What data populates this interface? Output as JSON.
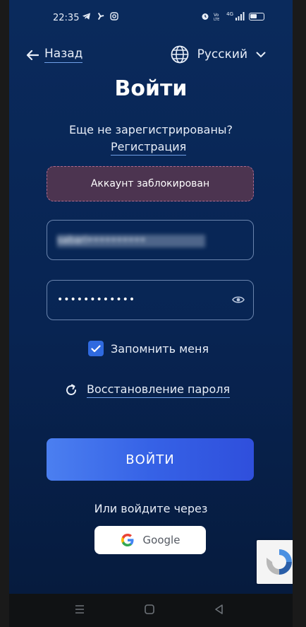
{
  "status_bar": {
    "time": "22:35",
    "left_icons": [
      "telegram-icon",
      "fan-icon",
      "instagram-icon"
    ],
    "right_icons": [
      "alarm-icon",
      "volte-icon",
      "signal-icon",
      "battery-icon"
    ],
    "network": "4G"
  },
  "header": {
    "back_label": "Назад",
    "language_label": "Русский"
  },
  "title": "Войти",
  "register_prompt": "Еще не зарегистрированы?",
  "register_link": "Регистрация",
  "alert_text": "Аккаунт заблокирован",
  "login_field": {
    "value": "sabari••••••••••"
  },
  "password_field": {
    "value": "••••••••••••"
  },
  "remember": {
    "label": "Запомнить меня",
    "checked": true
  },
  "recover_label": "Восстановление пароля",
  "login_button_label": "ВОЙТИ",
  "or_via_label": "Или войдите через",
  "google_button_label": "Google",
  "colors": {
    "background_top": "#0a2a5c",
    "primary_button": "#3662e6",
    "alert_bg": "#4c3450",
    "alert_border": "#b06a8e",
    "link_underline": "#6fa0e8"
  }
}
